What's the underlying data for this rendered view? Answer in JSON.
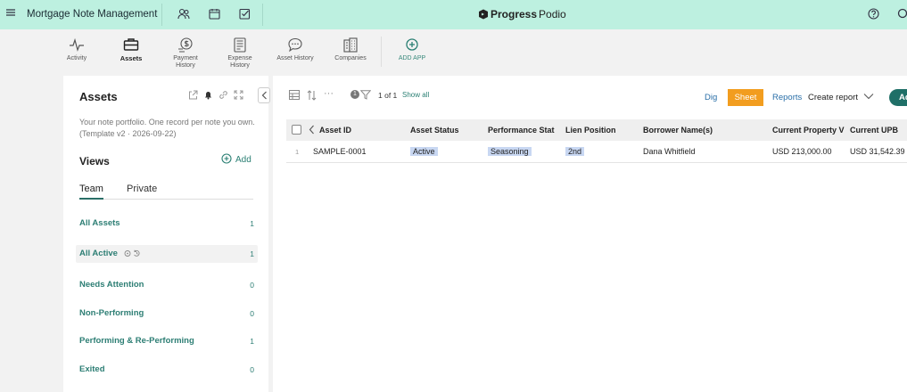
{
  "topbar": {
    "workspace_title": "Mortgage Note Management",
    "brand_name": "Progress",
    "brand_product": "Podio"
  },
  "apps": [
    {
      "label": "Activity",
      "icon": "activity-icon"
    },
    {
      "label": "Assets",
      "icon": "briefcase-icon"
    },
    {
      "label": "Payment\nHistory",
      "icon": "dollar-circle-icon"
    },
    {
      "label": "Expense\nHistory",
      "icon": "receipt-icon"
    },
    {
      "label": "Asset History",
      "icon": "speech-bubble-icon"
    },
    {
      "label": "Companies",
      "icon": "buildings-icon"
    },
    {
      "label": "ADD APP",
      "icon": "plus-circle-icon"
    }
  ],
  "sidebar": {
    "title": "Assets",
    "description": "Your note portfolio. One record per note you own. (Template v2 · 2026-09-22)",
    "views_heading": "Views",
    "add_label": "Add",
    "tabs": [
      "Team",
      "Private"
    ],
    "views": [
      {
        "label": "All Assets",
        "count": "1"
      },
      {
        "label": "All Active",
        "count": "1"
      },
      {
        "label": "Needs Attention",
        "count": "0"
      },
      {
        "label": "Non-Performing",
        "count": "0"
      },
      {
        "label": "Performing & Re-Performing",
        "count": "1"
      },
      {
        "label": "Exited",
        "count": "0"
      }
    ]
  },
  "toolbar": {
    "filter_count": "1",
    "page_info": "1 of 1",
    "show_all": "Show all",
    "dig": "Dig",
    "sheet": "Sheet",
    "reports": "Reports",
    "create_report": "Create report",
    "add": "Ad"
  },
  "table": {
    "columns": [
      "Asset ID",
      "Asset Status",
      "Performance Stat",
      "Lien Position",
      "Borrower Name(s)",
      "Current Property V",
      "Current UPB"
    ],
    "rows": [
      {
        "num": "1",
        "cells": [
          "SAMPLE-0001",
          "Active",
          "Seasoning",
          "2nd",
          "Dana Whitfield",
          "USD 213,000.00",
          "USD 31,542.39"
        ]
      }
    ]
  },
  "colors": {
    "topbar_bg": "#bdf0e0",
    "accent_teal": "#1f6f67",
    "sheet_orange": "#f29d1f",
    "link_blue": "#2a6fa8",
    "chip_blue": "#c8d7f2"
  }
}
